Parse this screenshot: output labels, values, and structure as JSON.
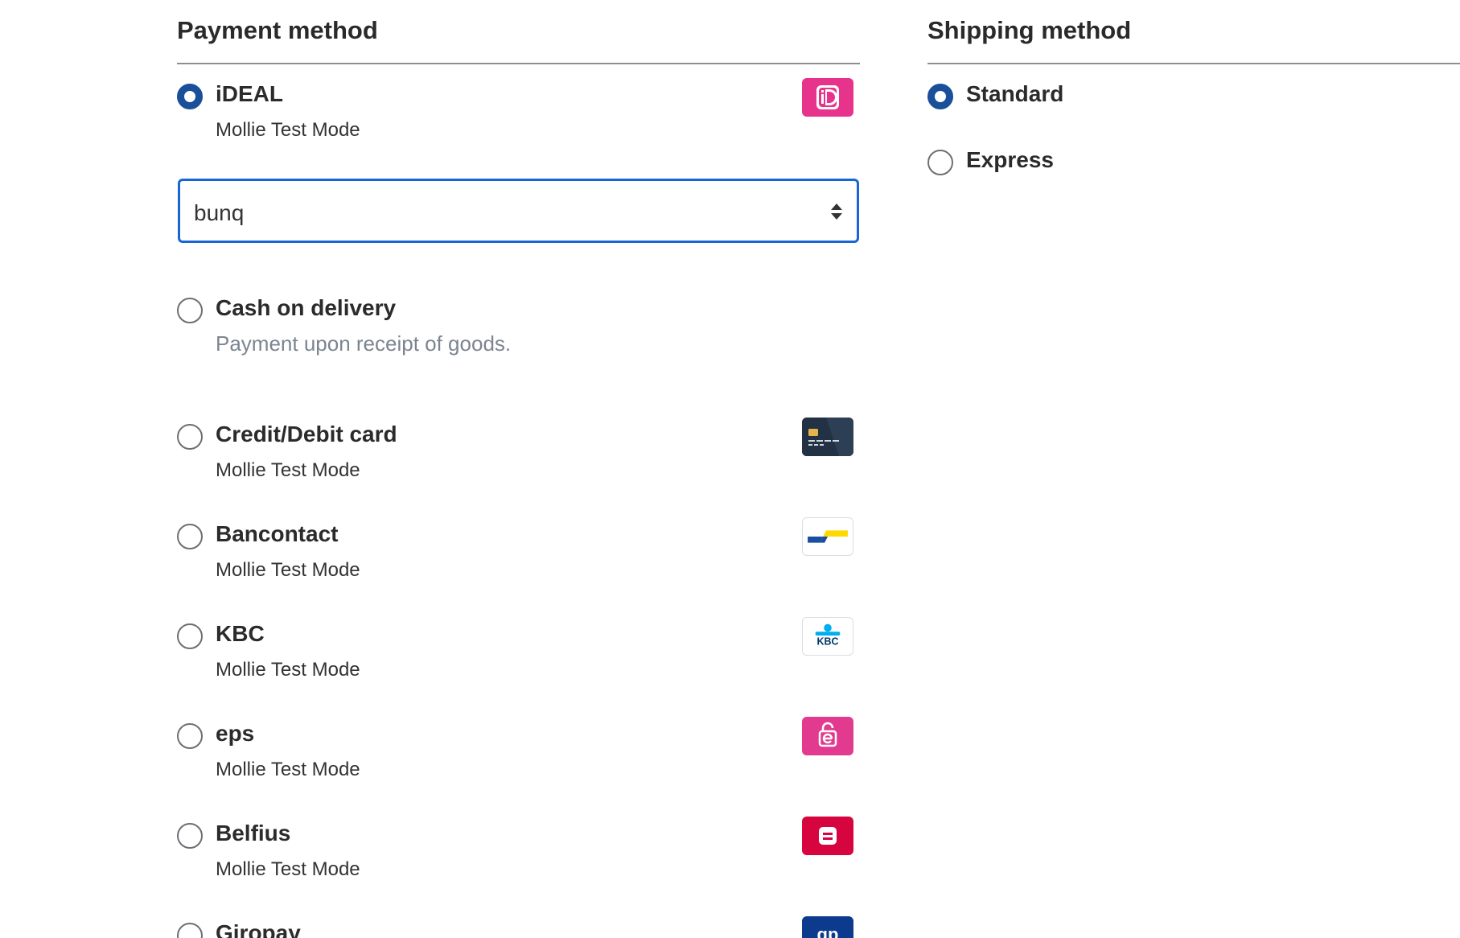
{
  "payment": {
    "title": "Payment method",
    "select": {
      "value": "bunq"
    },
    "methods": [
      {
        "title": "iDEAL",
        "subtitle": "Mollie Test Mode",
        "checked": true,
        "icon": "ideal-logo-icon",
        "color": "#e8338c"
      },
      {
        "title": "Cash on delivery",
        "subtitle": "Payment upon receipt of goods.",
        "checked": false
      },
      {
        "title": "Credit/Debit card",
        "subtitle": "Mollie Test Mode",
        "checked": false,
        "icon": "credit-card-logo-icon",
        "color": "#243446"
      },
      {
        "title": "Bancontact",
        "subtitle": "Mollie Test Mode",
        "checked": false,
        "icon": "bancontact-logo-icon",
        "color": "#ffffff"
      },
      {
        "title": "KBC",
        "subtitle": "Mollie Test Mode",
        "checked": false,
        "icon": "kbc-logo-icon",
        "color": "#ffffff"
      },
      {
        "title": "eps",
        "subtitle": "Mollie Test Mode",
        "checked": false,
        "icon": "eps-logo-icon",
        "color": "#e23a8f"
      },
      {
        "title": "Belfius",
        "subtitle": "Mollie Test Mode",
        "checked": false,
        "icon": "belfius-logo-icon",
        "color": "#d7053f"
      },
      {
        "title": "Giropay",
        "checked": false,
        "icon": "giropay-logo-icon",
        "color": "#0c3a8c"
      }
    ]
  },
  "shipping": {
    "title": "Shipping method",
    "methods": [
      {
        "title": "Standard",
        "checked": true
      },
      {
        "title": "Express",
        "checked": false
      }
    ]
  },
  "colors": {
    "accent": "#1a4f99",
    "focus_border": "#1666d6",
    "divider": "#8a8f94"
  }
}
